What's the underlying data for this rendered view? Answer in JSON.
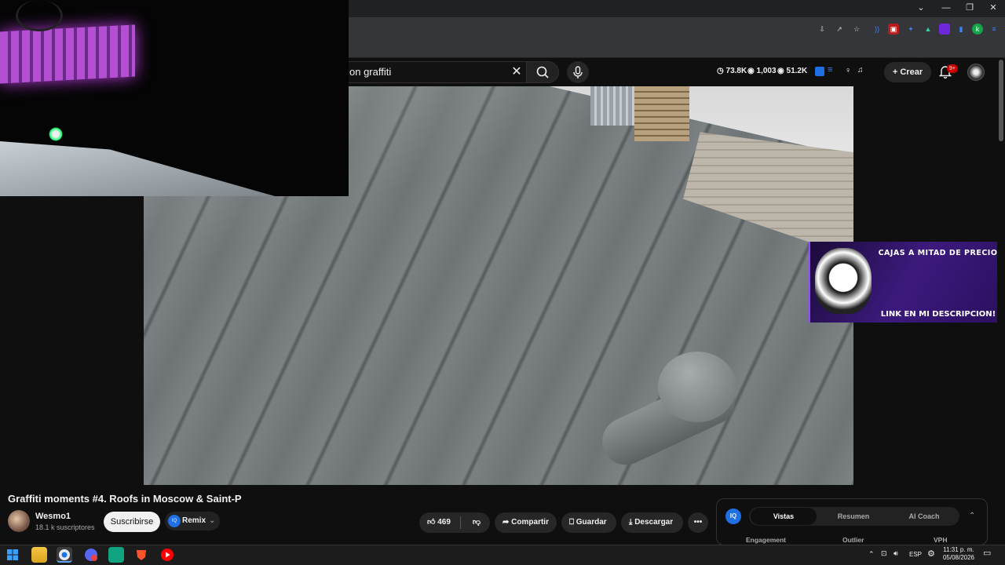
{
  "search": {
    "query": "on graffiti"
  },
  "header_stats": {
    "s1": "73.8K",
    "s2": "1,003",
    "s3": "51.2K"
  },
  "header": {
    "create_label": "Crear",
    "notif_count": "9+"
  },
  "promo": {
    "top_text": "CAJAS A MITAD DE PRECIO",
    "bottom_text": "LINK EN MI DESCRIPCION!"
  },
  "video": {
    "title": "Graffiti moments #4. Roofs in Moscow & Saint-P",
    "channel": "Wesmo1",
    "subscribers": "18.1 k suscriptores",
    "subscribe_label": "Suscribirse",
    "remix_label": "Remix",
    "iq_label": "IQ",
    "likes": "469",
    "share_label": "Compartir",
    "save_label": "Guardar",
    "download_label": "Descargar"
  },
  "panel": {
    "iq": "IQ",
    "tabs": [
      "Vistas",
      "Resumen",
      "AI Coach"
    ],
    "columns": [
      "Engagement",
      "Outlier",
      "VPH"
    ]
  },
  "taskbar": {
    "lang": "ESP",
    "time": "11:31 p. m.",
    "date": "05/08/2026"
  },
  "colors": {
    "accent": "#1f6fe5",
    "badge": "#cc0000",
    "promo": "#3c1a7d"
  }
}
